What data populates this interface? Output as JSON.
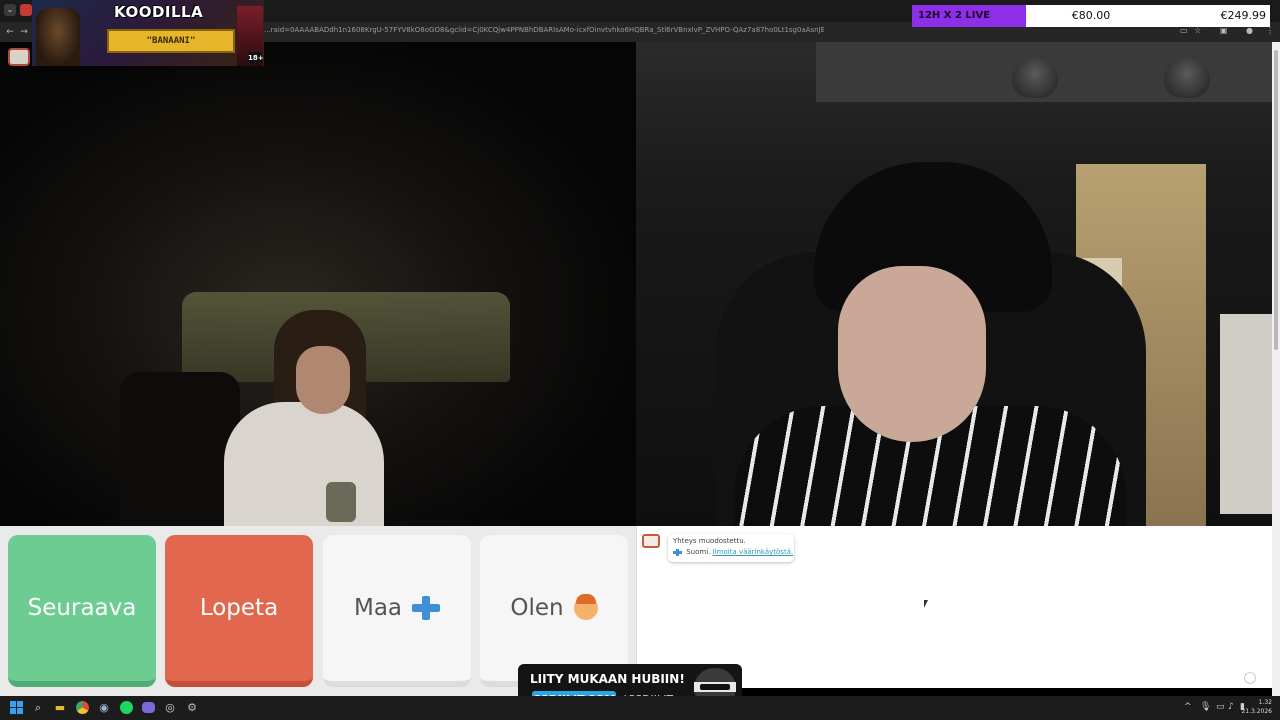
{
  "browser": {
    "url": "...raid=0AAAABADdh1n1608KrgU-57FYV8kO8oGO8&gclid=Cj0KCQjw4PPNBhDBARIsAMo-icxfOinvtvhko6HQBRa_Stl6rVBnxlvP_ZVHPO-QAz7a87ho0Lt1sg0aAsnJEALw_wcB",
    "back_glyph": "←",
    "forward_glyph": "→",
    "reload_glyph": "↻",
    "tab_glyph": "⌄",
    "install_icon": "install-icon",
    "star_icon": "star-icon",
    "extensions_icon": "extensions-icon",
    "profile_icon": "profile-icon",
    "menu_icon": "kebab-menu-icon",
    "star_glyph": "☆",
    "menu_glyph": "⋮"
  },
  "stream_overlay": {
    "title": "KOODILLA",
    "code": "\"BANAANI\"",
    "age_badge": "18+"
  },
  "donation_bar": {
    "live_label": "12H X 2 LIVE",
    "goal": "€80.00",
    "total": "€249.99",
    "live_color": "#8f2ee8"
  },
  "controls": {
    "next_label": "Seuraava",
    "stop_label": "Lopeta",
    "country_label": "Maa",
    "gender_label": "Olen",
    "next_color": "#6ccc91",
    "stop_color": "#e2674f",
    "country_icon": "finland-flag-icon",
    "gender_icon": "person-emoji-icon"
  },
  "chat": {
    "status": "Yhteys muodostettu.",
    "country": "Suomi.",
    "report_link": "Ilmoita väärinkäytöstä."
  },
  "promo": {
    "title": "LIITY MUKAAN HUBIIN!",
    "site": "CSDIILIT.COM",
    "command": "!CSDIILIT"
  },
  "taskbar": {
    "time": "1.32",
    "date": "21.3.2026",
    "search_glyph": "⌕",
    "tray_up": "^",
    "tray_mic": "🎙",
    "tray_net": "▭",
    "tray_vol": "♪",
    "tray_bat": "▮",
    "apps": [
      "start-icon",
      "search-icon",
      "file-explorer-icon",
      "chrome-icon",
      "steam-icon",
      "spotify-icon",
      "discord-icon",
      "obs-icon",
      "settings-icon"
    ]
  }
}
